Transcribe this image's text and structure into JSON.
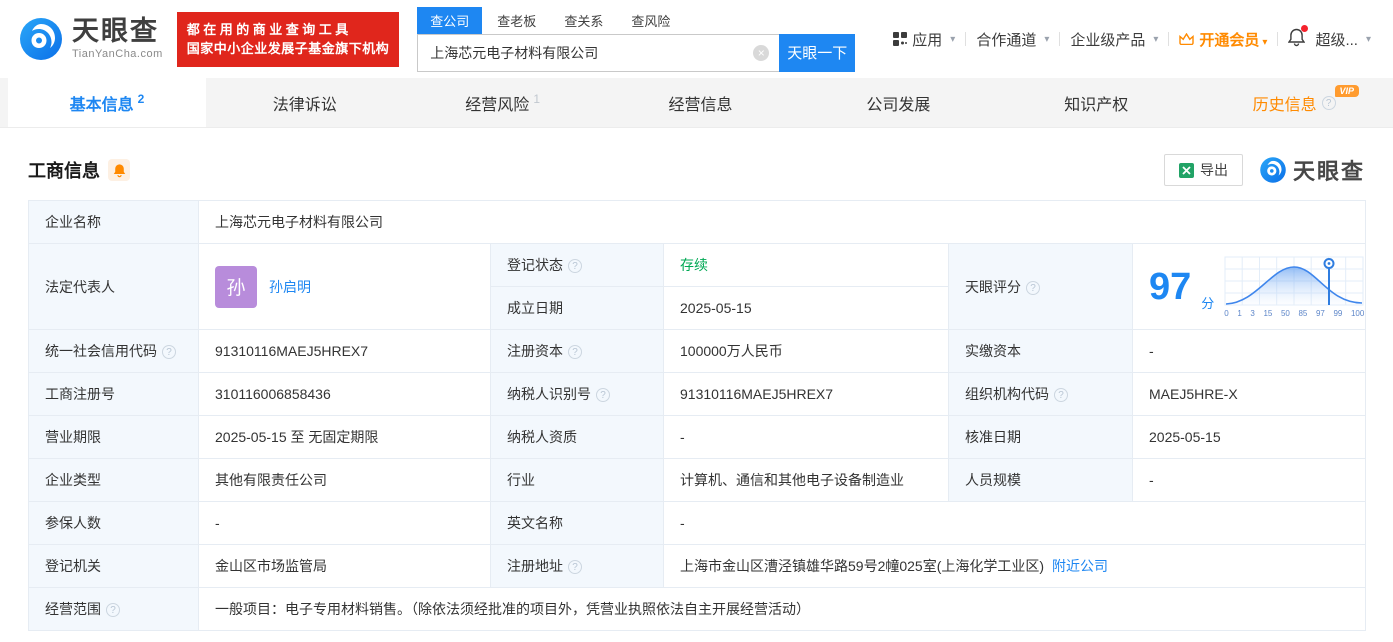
{
  "header": {
    "brand": "天眼查",
    "brand_domain": "TianYanCha.com",
    "slogan_line1": "都在用的商业查询工具",
    "slogan_line2": "国家中小企业发展子基金旗下机构",
    "search_tabs": [
      {
        "label": "查公司"
      },
      {
        "label": "查老板"
      },
      {
        "label": "查关系"
      },
      {
        "label": "查风险"
      }
    ],
    "search_value": "上海芯元电子材料有限公司",
    "search_button": "天眼一下",
    "nav_app": "应用",
    "nav_partner": "合作通道",
    "nav_enterprise": "企业级产品",
    "nav_vip": "开通会员",
    "nav_super": "超级..."
  },
  "tabs": {
    "basic": {
      "label": "基本信息",
      "count": "2"
    },
    "legal": {
      "label": "法律诉讼"
    },
    "risk": {
      "label": "经营风险",
      "count": "1"
    },
    "operation": {
      "label": "经营信息"
    },
    "development": {
      "label": "公司发展"
    },
    "ip": {
      "label": "知识产权"
    },
    "history": {
      "label": "历史信息",
      "badge": "VIP"
    }
  },
  "section": {
    "title": "工商信息",
    "export_label": "导出",
    "watermark": "天眼查"
  },
  "info": {
    "company_name": {
      "label": "企业名称",
      "value": "上海芯元电子材料有限公司"
    },
    "legal_rep": {
      "label": "法定代表人",
      "value": "孙启明",
      "avatar": "孙"
    },
    "reg_status": {
      "label": "登记状态",
      "value": "存续"
    },
    "establish_date": {
      "label": "成立日期",
      "value": "2025-05-15"
    },
    "credit_code": {
      "label": "统一社会信用代码",
      "value": "91310116MAEJ5HREX7"
    },
    "reg_capital": {
      "label": "注册资本",
      "value": "100000万人民币"
    },
    "paid_capital": {
      "label": "实缴资本",
      "value": "-"
    },
    "reg_number": {
      "label": "工商注册号",
      "value": "310116006858436"
    },
    "taxpayer_id": {
      "label": "纳税人识别号",
      "value": "91310116MAEJ5HREX7"
    },
    "org_code": {
      "label": "组织机构代码",
      "value": "MAEJ5HRE-X"
    },
    "business_term": {
      "label": "营业期限",
      "value": "2025-05-15 至 无固定期限"
    },
    "taxpayer_qualification": {
      "label": "纳税人资质",
      "value": "-"
    },
    "approval_date": {
      "label": "核准日期",
      "value": "2025-05-15"
    },
    "company_type": {
      "label": "企业类型",
      "value": "其他有限责任公司"
    },
    "industry": {
      "label": "行业",
      "value": "计算机、通信和其他电子设备制造业"
    },
    "staff_size": {
      "label": "人员规模",
      "value": "-"
    },
    "insured_count": {
      "label": "参保人数",
      "value": "-"
    },
    "english_name": {
      "label": "英文名称",
      "value": "-"
    },
    "registry_authority": {
      "label": "登记机关",
      "value": "金山区市场监管局"
    },
    "reg_address": {
      "label": "注册地址",
      "value": "上海市金山区漕泾镇雄华路59号2幢025室(上海化学工业区)",
      "link": "附近公司"
    },
    "business_scope": {
      "label": "经营范围",
      "value": "一般项目：电子专用材料销售。（除依法须经批准的项目外，凭营业执照依法自主开展经营活动）"
    }
  },
  "score": {
    "label": "天眼评分",
    "value": "97",
    "unit": "分"
  },
  "chart_data": {
    "type": "area",
    "title": "天眼评分分布曲线",
    "x_tick_labels": [
      "0",
      "1",
      "3",
      "15",
      "50",
      "85",
      "97",
      "99",
      "100"
    ],
    "score": 97,
    "marker_value": 97,
    "curve_shape": "bell",
    "peak_at_tick": "50",
    "grid": true,
    "accent_color": "#1e87f2"
  }
}
